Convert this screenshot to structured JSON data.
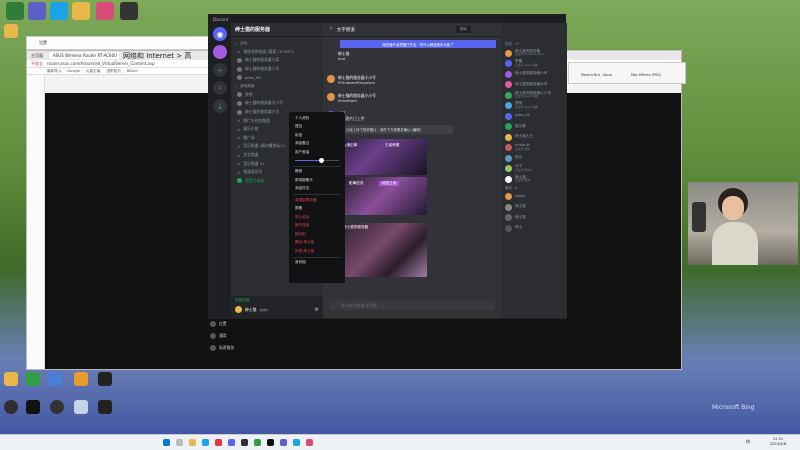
{
  "desktop": {
    "top_icons": [
      {
        "name": "p-app-icon",
        "color": "#2f7d3a"
      },
      {
        "name": "teams-icon",
        "color": "#5b5fc7"
      },
      {
        "name": "qq-icon",
        "color": "#1aa3e8"
      },
      {
        "name": "folder-icon",
        "color": "#e8b84a"
      },
      {
        "name": "colorful-app-icon",
        "color": "#d94c7a"
      },
      {
        "name": "cat-icon",
        "color": "#333333"
      }
    ],
    "bottom_icons": [
      {
        "name": "yellow-folder-icon",
        "color": "#e8b84a"
      },
      {
        "name": "green-app-icon",
        "color": "#2f9e44"
      },
      {
        "name": "blue-folder-icon",
        "color": "#4a7fd9"
      },
      {
        "name": "orange-folder-icon",
        "color": "#e89b2c"
      },
      {
        "name": "tz-app-icon",
        "color": "#222222"
      },
      {
        "name": "obs-icon",
        "color": "#302e31"
      },
      {
        "name": "capcut-icon",
        "color": "#111111"
      },
      {
        "name": "arrow-app-icon",
        "color": "#333333"
      },
      {
        "name": "mascot-app-icon",
        "color": "#c2d4e8"
      },
      {
        "name": "tz2-app-icon",
        "color": "#222222"
      }
    ],
    "watermark": "Microsoft Bing"
  },
  "settings_window": {
    "title": "设置",
    "field": "主页面"
  },
  "browser": {
    "heading": "网络和 Internet > 高",
    "tab_label": "ASUS Wireless Router RT-AC66U",
    "address": "router.asus.com/Advanced_VirtualServer_Content.asp",
    "address_prefix": "不安全",
    "bookmarks": [
      "最新导入",
      "Google",
      "火影忍者",
      "进阶知识",
      "Bilibili"
    ],
    "right_tabs": [
      "Mantra Bra - Kaua",
      "Mac Effects (PSD)"
    ]
  },
  "discord": {
    "window_title": "Discord",
    "server_name": "绅士猫的服务器",
    "channel_header": "文字频道",
    "notice": "服务器升级提醒已开启：您可以解锁更多功能了",
    "toolbar_search": "搜索",
    "channels": [
      {
        "label": "活动",
        "type": "cat"
      },
      {
        "label": "系统消息频道 (需要 (TICKET)",
        "type": "text"
      },
      {
        "label": "绅士猫的服务器小菜",
        "type": "voice"
      },
      {
        "label": "绅士猫的服务器小号",
        "type": "voice"
      },
      {
        "label": "pdos_95",
        "type": "voice"
      },
      {
        "label": "游戏频道",
        "type": "cat"
      },
      {
        "label": "罗顿",
        "type": "voice"
      },
      {
        "label": "绅士猫的服务器大小号",
        "type": "voice"
      },
      {
        "label": "绅士猫的服务器大号",
        "type": "voice"
      },
      {
        "label": "帮仁与任务频道",
        "type": "text"
      },
      {
        "label": "娱乐小筑",
        "type": "text"
      },
      {
        "label": "聊广场",
        "type": "text"
      },
      {
        "label": "音乐频道 (请勿播放私人)",
        "type": "text"
      },
      {
        "label": "文字频道",
        "type": "text"
      },
      {
        "label": "音乐频道 01",
        "type": "text"
      },
      {
        "label": "频道成员号",
        "type": "text"
      },
      {
        "label": "语音已连接",
        "type": "voice-connected"
      }
    ],
    "voice_panel": {
      "label": "语音连接",
      "sub": "绅士猫的服务器"
    },
    "user_panel": {
      "name": "绅士猫",
      "tag": "在线中"
    },
    "messages": [
      {
        "author": "绅士猫",
        "text": "end"
      },
      {
        "author": "绅士猫的服务器小小号",
        "text": "ElfrudsamRingalom"
      },
      {
        "author": "绅士猫的服务器小小号",
        "text": "linfusfood"
      },
      {
        "author": "梦晨",
        "text": "全部图片已上传"
      }
    ],
    "quote_text": "已经上传了相关图片，请在下方查看并确认 (编辑)",
    "image_captions": [
      {
        "left": "九鬼旧事",
        "right": "王者荣耀"
      },
      {
        "left": "影舞逆流",
        "right": "秘密之地"
      },
      {
        "left": "绅士猫的服务器",
        "right": ""
      }
    ],
    "input_placeholder": "给 #文字频道 发消息",
    "members_heading": "在线 - 17",
    "members_offline_heading": "离线 - 4",
    "members": [
      {
        "name": "绅士猫的服务器",
        "status": "正在玩 Celebrity Pool",
        "color": "#e8944a"
      },
      {
        "name": "梦晨",
        "status": "正在玩 Apex 英雄",
        "color": "#5865f2"
      },
      {
        "name": "绅士猫的服务器小号",
        "status": "",
        "color": "#a35ce0"
      },
      {
        "name": "绅士猫的服务器大号",
        "status": "",
        "color": "#e05c9a"
      },
      {
        "name": "绅士猫的服务器小小号",
        "status": "正在玩 Apex 英雄",
        "color": "#3ba55c"
      },
      {
        "name": "罗顿",
        "status": "正在玩 Apex 英雄",
        "color": "#4aa3e0"
      },
      {
        "name": "pdos_95",
        "status": "",
        "color": "#5865f2"
      },
      {
        "name": "猫头鹰",
        "status": "",
        "color": "#23a55a"
      },
      {
        "name": "绅士猫大王",
        "status": "",
        "color": "#e8b84a"
      },
      {
        "name": "mutantt",
        "status": "正在玩 原神",
        "color": "#c55a5a"
      },
      {
        "name": "夜空",
        "status": "",
        "color": "#5a9ac5"
      },
      {
        "name": "叶子",
        "status": "正在玩 原神 2",
        "color": "#9ac55a"
      },
      {
        "name": "绅士猫",
        "status": "正在玩 原神",
        "color": "#ffffff"
      },
      {
        "name": "Alpha",
        "status": "",
        "color": "#e8944a"
      },
      {
        "name": "绅士猫",
        "status": "",
        "color": "#888888"
      },
      {
        "name": "绅士猫",
        "status": "",
        "color": "#666666"
      },
      {
        "name": "绅士",
        "status": "",
        "color": "#555555"
      }
    ],
    "context_menu": [
      {
        "label": "个人资料",
        "kind": "normal"
      },
      {
        "label": "提及",
        "kind": "normal"
      },
      {
        "label": "私信",
        "kind": "normal"
      },
      {
        "label": "添加备注",
        "kind": "normal"
      },
      {
        "label": "用户音量",
        "kind": "normal"
      },
      {
        "label": "",
        "kind": "slider",
        "value": 0.6
      },
      {
        "label": "静音",
        "kind": "normal"
      },
      {
        "label": "禁用摄像头",
        "kind": "normal"
      },
      {
        "label": "添加好友",
        "kind": "normal"
      },
      {
        "label": "邀请至服务器",
        "kind": "danger"
      },
      {
        "label": "屏蔽",
        "kind": "normal"
      },
      {
        "label": "禁止说话",
        "kind": "danger"
      },
      {
        "label": "断开连接",
        "kind": "danger"
      },
      {
        "label": "移动到",
        "kind": "danger"
      },
      {
        "label": "踢出 绅士猫",
        "kind": "danger"
      },
      {
        "label": "封禁 绅士猫",
        "kind": "danger"
      },
      {
        "label": "身份组",
        "kind": "normal"
      }
    ]
  },
  "lower_list": [
    "位置",
    "通用",
    "私密服务"
  ],
  "taskbar": {
    "time": "12:31",
    "date": "2024/4/8",
    "lang": "拼"
  }
}
